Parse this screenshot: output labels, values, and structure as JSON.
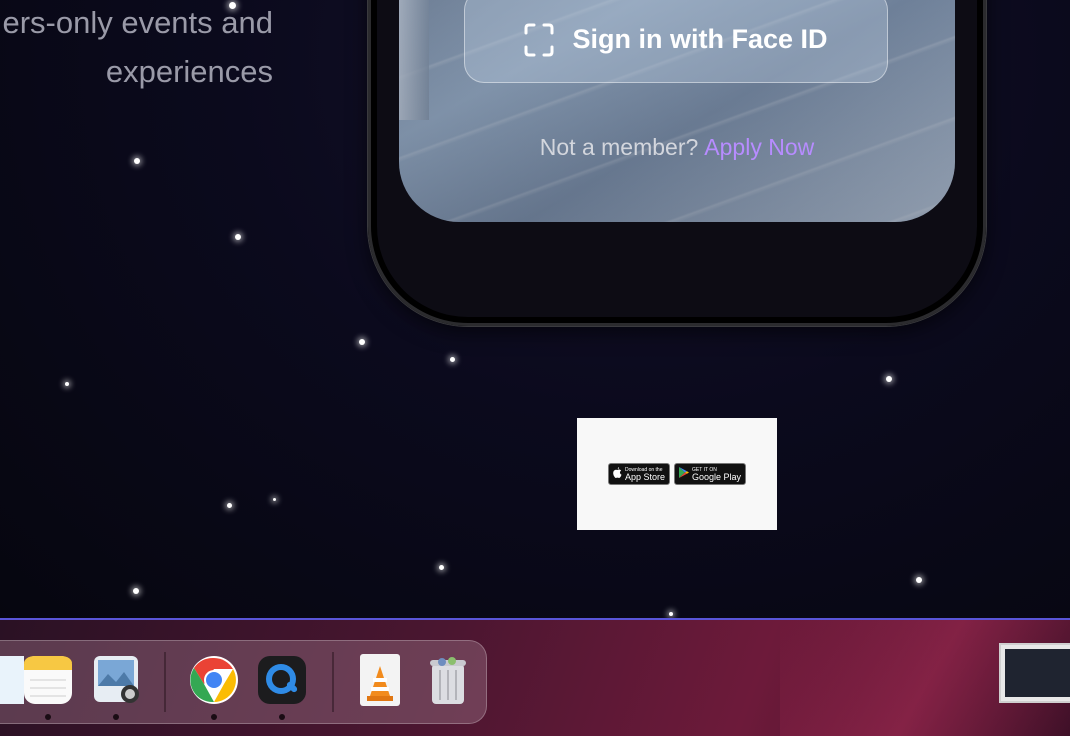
{
  "tagline": {
    "line1": "ers-only events and",
    "line2": "experiences"
  },
  "phone": {
    "faceid_label": "Sign in with Face ID",
    "not_member": "Not a member?",
    "apply_now": "Apply Now"
  },
  "store_badges": {
    "apple": {
      "small": "Download on the",
      "big": "App Store"
    },
    "google": {
      "small": "GET IT ON",
      "big": "Google Play"
    }
  },
  "dock": {
    "apps": [
      "finder-icon",
      "notes-icon",
      "preview-icon",
      "chrome-icon",
      "quicktime-icon",
      "vlc-icon",
      "trash-icon"
    ]
  },
  "colors": {
    "accent": "#b78cff",
    "divider": "#5a55d8"
  }
}
